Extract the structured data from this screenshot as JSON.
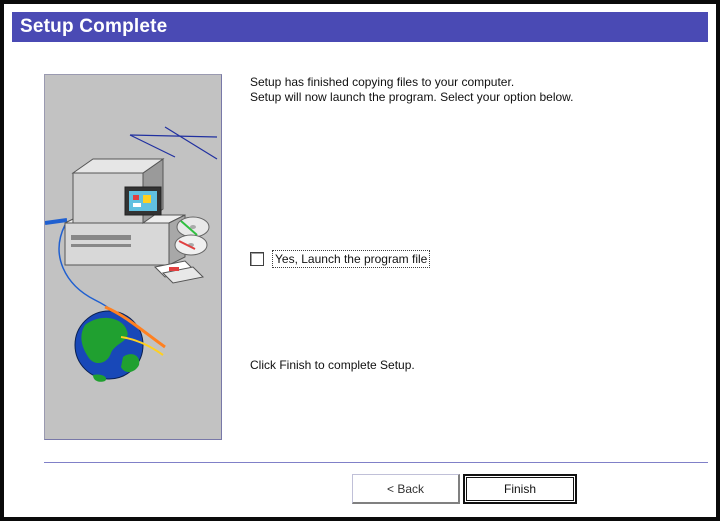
{
  "window": {
    "title": "Setup Complete"
  },
  "main": {
    "message_line1": "Setup has finished copying files to your computer.",
    "message_line2": "Setup will now launch the program. Select your option below.",
    "launch_checkbox": {
      "label": "Yes, Launch the program file",
      "checked": false
    },
    "finish_note": "Click Finish to complete Setup."
  },
  "buttons": {
    "back": "< Back",
    "finish": "Finish"
  },
  "colors": {
    "titlebar": "#4a4ab4",
    "art_bg": "#c2c2c2"
  },
  "art": {
    "icons": [
      "computer-icon",
      "cd-icon",
      "globe-icon",
      "floppy-icon",
      "network-cable-icon"
    ]
  }
}
